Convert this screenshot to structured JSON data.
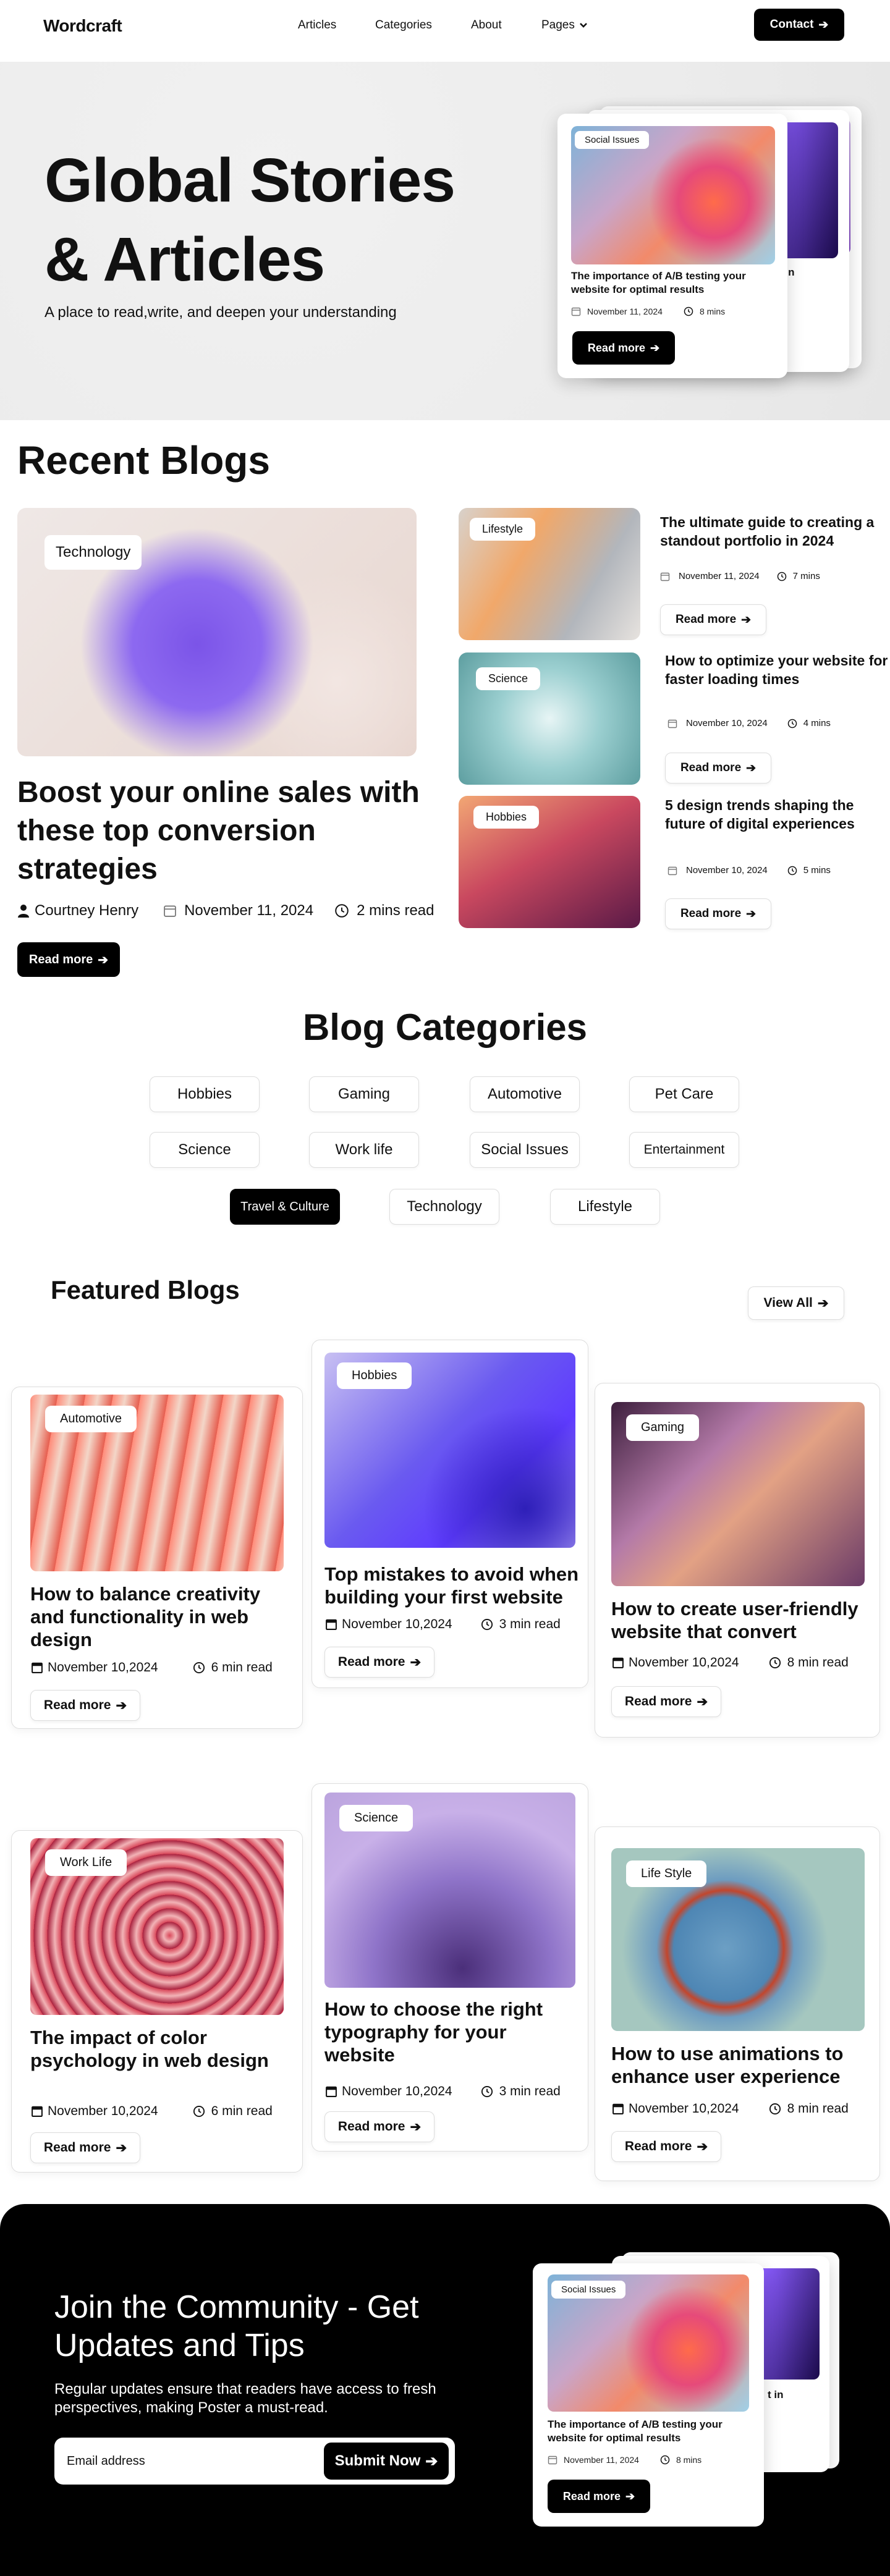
{
  "nav": {
    "logo": "Wordcraft",
    "items": [
      "Articles",
      "Categories",
      "About",
      "Pages"
    ],
    "contact": "Contact"
  },
  "hero": {
    "title_line1": "Global Stories",
    "title_line2": "& Articles",
    "subtitle": "A place to read,write, and deepen your understanding",
    "card": {
      "tag": "Social Issues",
      "title": "The importance of A/B testing your website for optimal results",
      "date": "November 11, 2024",
      "read": "8 mins",
      "button": "Read more",
      "back_snippet": "t in"
    }
  },
  "recent": {
    "title": "Recent Blogs",
    "main": {
      "tag": "Technology",
      "title": "Boost your online sales with these top conversion strategies",
      "author": "Courtney Henry",
      "date": "November 11, 2024",
      "read": "2 mins read",
      "button": "Read more"
    },
    "side": [
      {
        "tag": "Lifestyle",
        "title": "The ultimate guide to creating a standout portfolio in 2024",
        "date": "November 11, 2024",
        "read": "7 mins",
        "button": "Read more"
      },
      {
        "tag": "Science",
        "title": "How to optimize your website for faster loading times",
        "date": "November 10, 2024",
        "read": "4 mins",
        "button": "Read more"
      },
      {
        "tag": "Hobbies",
        "title": "5 design trends shaping the future of digital experiences",
        "date": "November 10, 2024",
        "read": "5 mins",
        "button": "Read more"
      }
    ]
  },
  "categories": {
    "title": "Blog Categories",
    "items": [
      "Hobbies",
      "Gaming",
      "Automotive",
      "Pet Care",
      "Science",
      "Work life",
      "Social Issues",
      "Entertainment",
      "Travel & Culture",
      "Technology",
      "Lifestyle"
    ],
    "active": "Travel & Culture"
  },
  "featured": {
    "title": "Featured Blogs",
    "view_all": "View All",
    "cards": [
      {
        "tag": "Automotive",
        "title": "How to balance creativity and functionality in web design",
        "date": "November 10,2024",
        "read": "6 min read",
        "button": "Read more"
      },
      {
        "tag": "Hobbies",
        "title": "Top mistakes to avoid when building your first website",
        "date": "November 10,2024",
        "read": "3 min read",
        "button": "Read more"
      },
      {
        "tag": "Gaming",
        "title": "How to create user-friendly website that convert",
        "date": "November 10,2024",
        "read": "8 min read",
        "button": "Read more"
      },
      {
        "tag": "Work Life",
        "title": "The impact of color psychology in web design",
        "date": "November 10,2024",
        "read": "6 min read",
        "button": "Read more"
      },
      {
        "tag": "Science",
        "title": "How to choose the right typography for your website",
        "date": "November 10,2024",
        "read": "3 min read",
        "button": "Read more"
      },
      {
        "tag": "Life Style",
        "title": "How to use animations to enhance user experience",
        "date": "November 10,2024",
        "read": "8 min read",
        "button": "Read more"
      }
    ]
  },
  "join": {
    "title": "Join the Community - Get Updates and Tips",
    "text": "Regular updates ensure that readers have access to fresh perspectives, making Poster a must-read.",
    "email_placeholder": "Email address",
    "submit": "Submit Now"
  },
  "icons": {
    "arrow": "arrow-right-icon",
    "calendar": "calendar-icon",
    "clock": "clock-icon",
    "user": "user-icon",
    "chevron": "chevron-down-icon"
  }
}
